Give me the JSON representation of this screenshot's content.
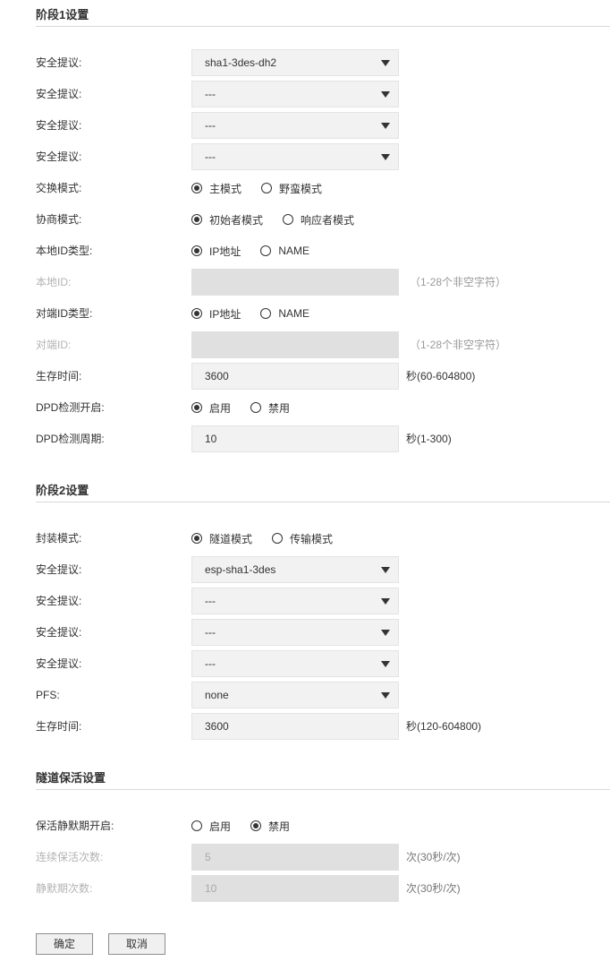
{
  "phase1": {
    "title": "阶段1设置",
    "proposal_label": "安全提议:",
    "proposals": [
      "sha1-3des-dh2",
      "---",
      "---",
      "---"
    ],
    "exchange_mode": {
      "label": "交换模式:",
      "options": [
        "主模式",
        "野蛮模式"
      ],
      "selected": 0
    },
    "negotiation_mode": {
      "label": "协商模式:",
      "options": [
        "初始者模式",
        "响应者模式"
      ],
      "selected": 0
    },
    "local_id_type": {
      "label": "本地ID类型:",
      "options": [
        "IP地址",
        "NAME"
      ],
      "selected": 0
    },
    "local_id": {
      "label": "本地ID:",
      "value": "",
      "hint": "（1-28个非空字符）"
    },
    "peer_id_type": {
      "label": "对端ID类型:",
      "options": [
        "IP地址",
        "NAME"
      ],
      "selected": 0
    },
    "peer_id": {
      "label": "对端ID:",
      "value": "",
      "hint": "（1-28个非空字符）"
    },
    "lifetime": {
      "label": "生存时间:",
      "value": "3600",
      "hint": "秒(60-604800)"
    },
    "dpd_enable": {
      "label": "DPD检测开启:",
      "options": [
        "启用",
        "禁用"
      ],
      "selected": 0
    },
    "dpd_period": {
      "label": "DPD检测周期:",
      "value": "10",
      "hint": "秒(1-300)"
    }
  },
  "phase2": {
    "title": "阶段2设置",
    "encap_mode": {
      "label": "封装模式:",
      "options": [
        "隧道模式",
        "传输模式"
      ],
      "selected": 0
    },
    "proposal_label": "安全提议:",
    "proposals": [
      "esp-sha1-3des",
      "---",
      "---",
      "---"
    ],
    "pfs": {
      "label": "PFS:",
      "value": "none"
    },
    "lifetime": {
      "label": "生存时间:",
      "value": "3600",
      "hint": "秒(120-604800)"
    }
  },
  "keepalive": {
    "title": "隧道保活设置",
    "silent_enable": {
      "label": "保活静默期开启:",
      "options": [
        "启用",
        "禁用"
      ],
      "selected": 1
    },
    "consecutive_count": {
      "label": "连续保活次数:",
      "value": "5",
      "hint": "次(30秒/次)"
    },
    "silent_count": {
      "label": "静默期次数:",
      "value": "10",
      "hint": "次(30秒/次)"
    }
  },
  "buttons": {
    "ok": "确定",
    "cancel": "取消"
  }
}
